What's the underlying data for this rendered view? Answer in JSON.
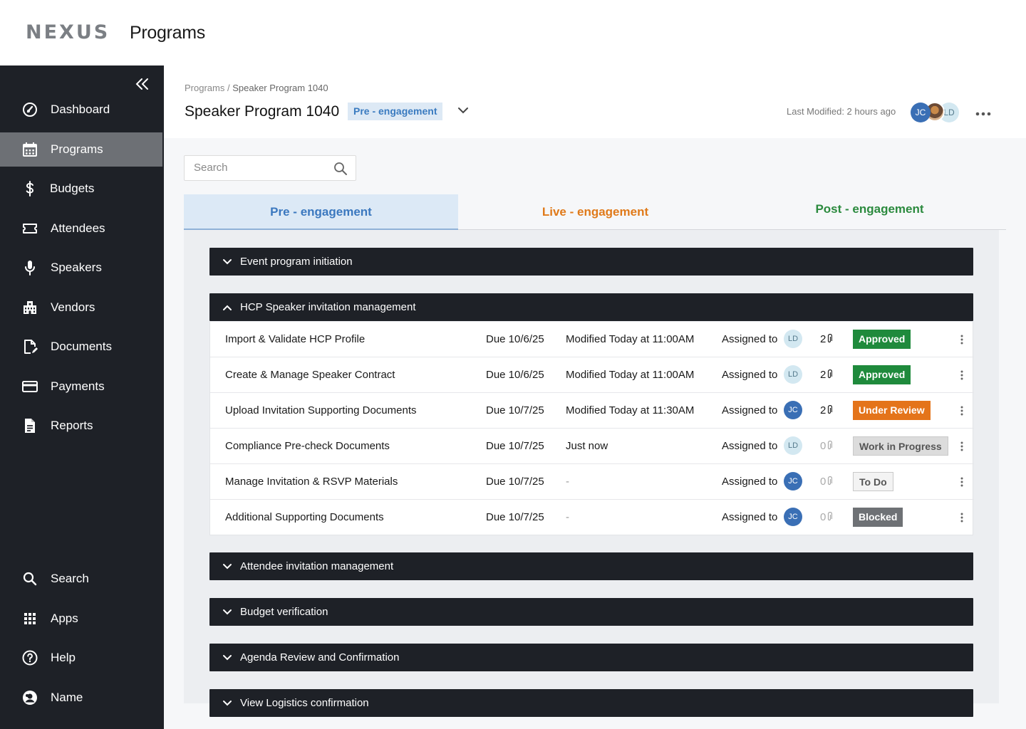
{
  "header": {
    "logo": "NEXUS",
    "app_title": "Programs"
  },
  "sidebar": {
    "collapse_icon": "double-chevron-left-icon",
    "items": [
      {
        "label": "Dashboard",
        "icon": "dashboard-gauge-icon",
        "active": false
      },
      {
        "label": "Programs",
        "icon": "calendar-icon",
        "active": true
      },
      {
        "label": "Budgets",
        "icon": "dollar-icon",
        "active": false
      },
      {
        "label": "Attendees",
        "icon": "ticket-icon",
        "active": false
      },
      {
        "label": "Speakers",
        "icon": "microphone-icon",
        "active": false
      },
      {
        "label": "Vendors",
        "icon": "building-icon",
        "active": false
      },
      {
        "label": "Documents",
        "icon": "document-edit-icon",
        "active": false
      },
      {
        "label": "Payments",
        "icon": "credit-card-icon",
        "active": false
      },
      {
        "label": "Reports",
        "icon": "report-icon",
        "active": false
      }
    ],
    "bottom_items": [
      {
        "label": "Search",
        "icon": "search-icon"
      },
      {
        "label": "Apps",
        "icon": "apps-grid-icon"
      },
      {
        "label": "Help",
        "icon": "help-icon"
      },
      {
        "label": "Name",
        "icon": "user-avatar-icon"
      }
    ]
  },
  "program": {
    "breadcrumb_root": "Programs",
    "breadcrumb_sep": " / ",
    "breadcrumb_current": "Speaker Program 1040",
    "title": "Speaker Program 1040",
    "stage": "Pre - engagement",
    "last_modified": "Last Modified: 2 hours ago",
    "avatars": [
      "JC",
      "LD"
    ]
  },
  "search": {
    "placeholder": "Search"
  },
  "tabs": [
    {
      "label": "Pre - engagement",
      "color": "#3b78bf",
      "active": true
    },
    {
      "label": "Live - engagement",
      "color": "#e07a1a",
      "active": false
    },
    {
      "label": "Post - engagement",
      "color": "#2b8a3e",
      "active": false
    }
  ],
  "sections": [
    {
      "title": "Event program initiation",
      "expanded": false
    },
    {
      "title": "HCP Speaker invitation management",
      "expanded": true
    },
    {
      "title": "Attendee invitation management",
      "expanded": false
    },
    {
      "title": "Budget verification",
      "expanded": false
    },
    {
      "title": "Agenda Review and Confirmation",
      "expanded": false
    },
    {
      "title": "View Logistics confirmation",
      "expanded": false
    }
  ],
  "tasks": [
    {
      "name": "Import & Validate HCP Profile",
      "due": "Due 10/6/25",
      "modified": "Modified Today at 11:00AM",
      "assigned_label": "Assigned to",
      "assignee": "LD",
      "attachments": "2",
      "status": "Approved",
      "status_kind": "approved"
    },
    {
      "name": "Create & Manage Speaker Contract",
      "due": "Due 10/6/25",
      "modified": "Modified Today at 11:00AM",
      "assigned_label": "Assigned to",
      "assignee": "LD",
      "attachments": "2",
      "status": "Approved",
      "status_kind": "approved"
    },
    {
      "name": "Upload Invitation Supporting Documents",
      "due": "Due 10/7/25",
      "modified": "Modified Today at 11:30AM",
      "assigned_label": "Assigned to",
      "assignee": "JC",
      "attachments": "2",
      "status": "Under Review",
      "status_kind": "review"
    },
    {
      "name": "Compliance Pre-check Documents",
      "due": "Due 10/7/25",
      "modified": "Just now",
      "assigned_label": "Assigned to",
      "assignee": "LD",
      "attachments": "0",
      "status": "Work in Progress",
      "status_kind": "wip"
    },
    {
      "name": "Manage Invitation & RSVP Materials",
      "due": "Due 10/7/25",
      "modified": "-",
      "assigned_label": "Assigned to",
      "assignee": "JC",
      "attachments": "0",
      "status": "To Do",
      "status_kind": "todo"
    },
    {
      "name": "Additional Supporting Documents",
      "due": "Due 10/7/25",
      "modified": "-",
      "assigned_label": "Assigned to",
      "assignee": "JC",
      "attachments": "0",
      "status": "Blocked",
      "status_kind": "blocked"
    }
  ]
}
